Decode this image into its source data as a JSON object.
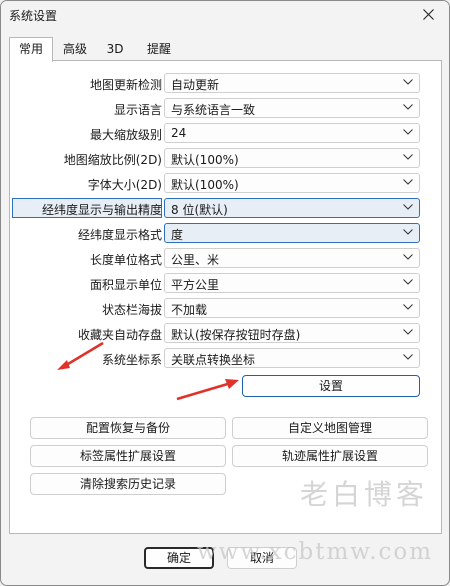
{
  "window": {
    "title": "系统设置"
  },
  "tabs": [
    "常用",
    "高级",
    "3D",
    "提醒"
  ],
  "settings": [
    {
      "label": "地图更新检测",
      "value": "自动更新"
    },
    {
      "label": "显示语言",
      "value": "与系统语言一致"
    },
    {
      "label": "最大缩放级别",
      "value": "24"
    },
    {
      "label": "地图缩放比例(2D)",
      "value": "默认(100%)"
    },
    {
      "label": "字体大小(2D)",
      "value": "默认(100%)"
    },
    {
      "label": "经纬度显示与输出精度",
      "value": "8 位(默认)"
    },
    {
      "label": "经纬度显示格式",
      "value": "度"
    },
    {
      "label": "长度单位格式",
      "value": "公里、米"
    },
    {
      "label": "面积显示单位",
      "value": "平方公里"
    },
    {
      "label": "状态栏海拔",
      "value": "不加载"
    },
    {
      "label": "收藏夹自动存盘",
      "value": "默认(按保存按钮时存盘)"
    },
    {
      "label": "系统坐标系",
      "value": "关联点转换坐标"
    }
  ],
  "buttons": {
    "settings": "设置",
    "config_restore": "配置恢复与备份",
    "custom_map": "自定义地图管理",
    "label_attr": "标签属性扩展设置",
    "track_attr": "轨迹属性扩展设置",
    "clear_search": "清除搜索历史记录",
    "ok": "确定",
    "cancel": "取消"
  },
  "watermark": {
    "line1": "老白博客",
    "line2": "www.xcbtmw.com"
  },
  "colors": {
    "accent": "#1f5fb2",
    "highlight": "#e8eef6",
    "arrow": "#e0322a"
  }
}
